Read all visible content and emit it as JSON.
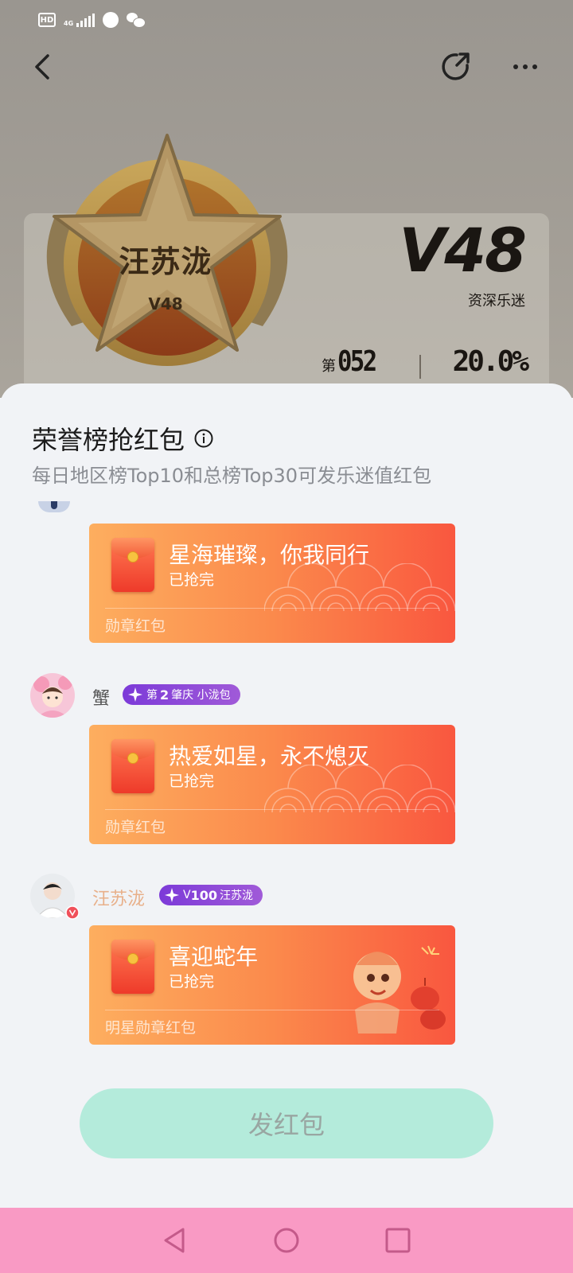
{
  "status_bar": {
    "hd_label": "HD",
    "network_label": "4G",
    "icons": [
      "hd-icon",
      "signal-icon",
      "globe-icon",
      "wechat-icon"
    ]
  },
  "top_bar": {
    "icons": [
      "back-icon",
      "share-icon",
      "more-icon"
    ]
  },
  "profile": {
    "medal_name": "汪苏泷",
    "medal_level": "V48",
    "level": "V48",
    "level_title": "资深乐迷",
    "rank_prefix": "第",
    "rank_number": "052",
    "percent": "20.0%"
  },
  "sheet": {
    "title": "荣誉榜抢红包",
    "subtitle": "每日地区榜Top10和总榜Top30可发乐迷值红包",
    "packets": [
      {
        "title": "星海璀璨，你我同行",
        "status": "已抢完",
        "footer": "勋章红包"
      },
      {
        "sender": "蟹",
        "badge_prefix": "第",
        "badge_number": "2",
        "badge_text": "肇庆 小泷包",
        "title": "热爱如星，永不熄灭",
        "status": "已抢完",
        "footer": "勋章红包"
      },
      {
        "sender": "汪苏泷",
        "badge_prefix": "V",
        "badge_number": "100",
        "badge_text": "汪苏泷",
        "title": "喜迎蛇年",
        "status": "已抢完",
        "footer": "明星勋章红包"
      }
    ],
    "send_button": "发红包"
  },
  "colors": {
    "packet_start": "#fdae5f",
    "packet_end": "#f9573f",
    "badge": "#8a48d8",
    "send_button": "#b4ebdb",
    "nav_bar": "#f99ac4"
  }
}
